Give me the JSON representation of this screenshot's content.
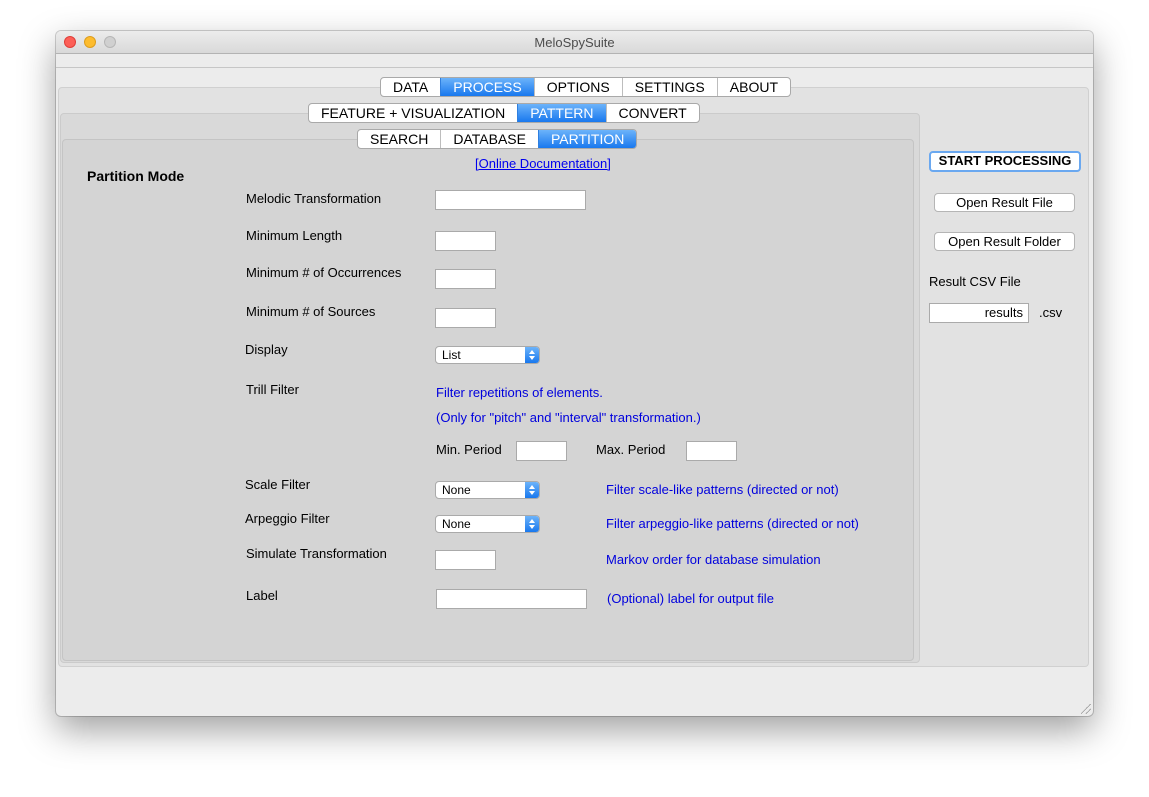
{
  "window": {
    "title": "MeloSpySuite"
  },
  "tabs": {
    "main": [
      "DATA",
      "PROCESS",
      "OPTIONS",
      "SETTINGS",
      "ABOUT"
    ],
    "process": [
      "FEATURE + VISUALIZATION",
      "PATTERN",
      "CONVERT"
    ],
    "pattern": [
      "SEARCH",
      "DATABASE",
      "PARTITION"
    ],
    "selected": {
      "main": "PROCESS",
      "process": "PATTERN",
      "pattern": "PARTITION"
    }
  },
  "content": {
    "doc_link": "[Online Documentation]",
    "mode_title": "Partition Mode",
    "fields": {
      "melodic_transformation": {
        "label": "Melodic Transformation",
        "value": ""
      },
      "minimum_length": {
        "label": "Minimum Length",
        "value": ""
      },
      "min_occurrences": {
        "label": "Minimum # of Occurrences",
        "value": ""
      },
      "min_sources": {
        "label": "Minimum # of Sources",
        "value": ""
      },
      "display": {
        "label": "Display",
        "value": "List"
      },
      "trill_filter": {
        "label": "Trill Filter",
        "desc1": "Filter repetitions of elements.",
        "desc2": "(Only for \"pitch\" and \"interval\" transformation.)",
        "min_period_label": "Min. Period",
        "min_period_value": "",
        "max_period_label": "Max. Period",
        "max_period_value": ""
      },
      "scale_filter": {
        "label": "Scale Filter",
        "value": "None",
        "desc": "Filter scale-like patterns (directed or not)"
      },
      "arpeggio_filter": {
        "label": "Arpeggio Filter",
        "value": "None",
        "desc": "Filter arpeggio-like patterns (directed or not)"
      },
      "simulate_transformation": {
        "label": "Simulate Transformation",
        "value": "",
        "desc": "Markov order for database simulation"
      },
      "label": {
        "label": "Label",
        "value": "",
        "desc": "(Optional) label for output file"
      }
    }
  },
  "side": {
    "start_button": "START PROCESSING",
    "open_file_button": "Open Result File",
    "open_folder_button": "Open Result Folder",
    "csv_label": "Result CSV File",
    "csv_value": "results",
    "csv_ext": ".csv"
  },
  "colors": {
    "selected_tab": "#1978ee",
    "description_text": "#0000dd",
    "link": "#0000ee"
  }
}
